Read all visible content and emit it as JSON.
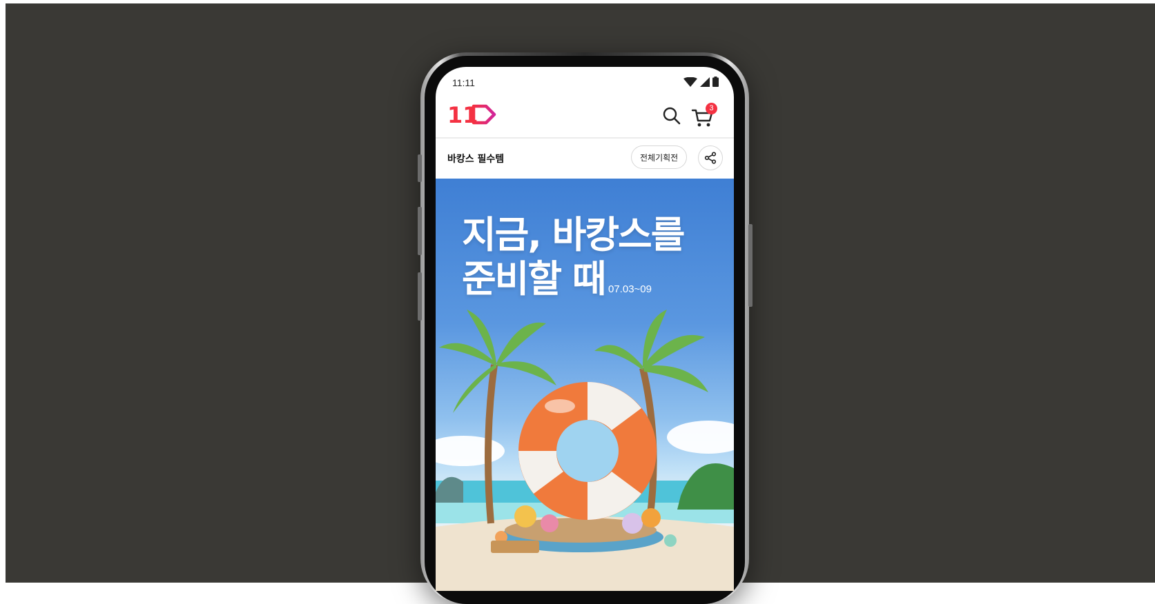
{
  "status_bar": {
    "time": "11:11"
  },
  "header": {
    "logo": "11",
    "cart_count": "3"
  },
  "page": {
    "title": "바캉스 필수템",
    "all_events_label": "전체기획전"
  },
  "banner": {
    "heading_line1": "지금, 바캉스를",
    "heading_line2": "준비할 때",
    "date_range": "07.03~09"
  },
  "colors": {
    "backdrop": "#3a3935",
    "brand_red": "#f43142",
    "brand_magenta": "#e8247a",
    "banner_sky": "#4f8ede",
    "ring_orange": "#f07a3c"
  },
  "icons": [
    "wifi-icon",
    "signal-icon",
    "battery-icon",
    "search-icon",
    "cart-icon",
    "share-icon"
  ]
}
